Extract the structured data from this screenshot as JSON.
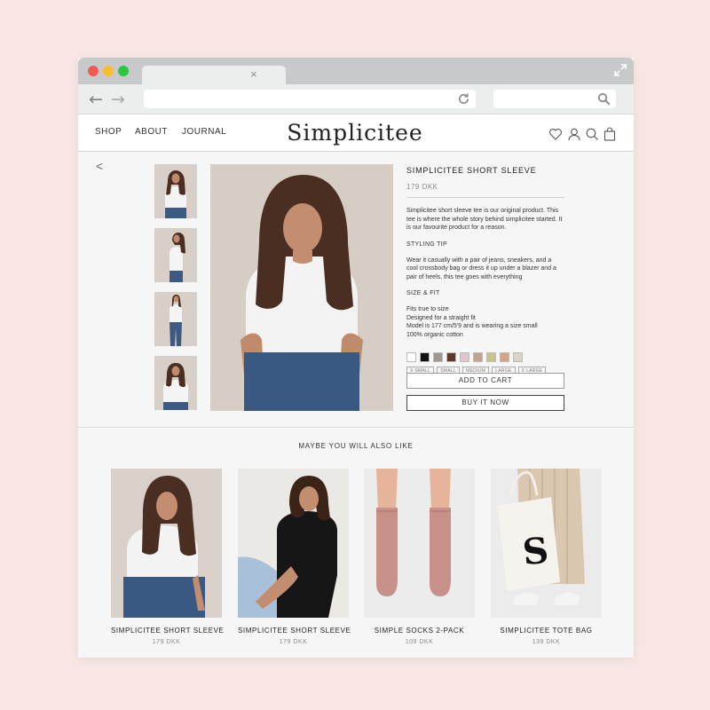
{
  "browser": {
    "icons": [
      "back-arrow-icon",
      "forward-arrow-icon",
      "reload-icon",
      "search-icon",
      "expand-icon",
      "close-icon"
    ],
    "back_glyph": "←",
    "forward_glyph": "→",
    "tab_close_glyph": "×"
  },
  "header": {
    "nav": [
      "SHOP",
      "ABOUT",
      "JOURNAL"
    ],
    "brand": "Simplicitee",
    "icons": [
      "heart-icon",
      "user-icon",
      "search-icon",
      "bag-icon"
    ]
  },
  "product": {
    "back_glyph": "<",
    "title": "SIMPLICITEE SHORT SLEEVE",
    "price": "179 DKK",
    "description": "Simplicitee short sleeve tee is our original product. This tee is where the whole story behind simplicitee started. It is our favourite product for a reason.",
    "styling_label": "STYLING TIP",
    "styling_text": "Wear it casually with a pair of jeans, sneakers, and a cool crossbody bag or dress it up under a blazer and a pair of heels, this tee goes with everything",
    "fit_label": "SIZE & FIT",
    "fit_lines": [
      "Fits true to size",
      "Designed for a straight fit",
      "Model is 177 cm/5'9 and is wearing a size small",
      "100% organic cotton"
    ],
    "colors": [
      "#ffffff",
      "#111111",
      "#a19690",
      "#5b3a2e",
      "#dfc6cb",
      "#c1a396",
      "#c7c58a",
      "#d6a38a",
      "#d8d4c6"
    ],
    "sizes": [
      "X SMALL",
      "SMALL",
      "MEDIUM",
      "LARGE",
      "X LARGE"
    ],
    "add_to_cart": "ADD TO CART",
    "buy_now": "BUY IT NOW"
  },
  "recommendations": {
    "title": "MAYBE YOU WILL ALSO LIKE",
    "items": [
      {
        "name": "SIMPLICITEE SHORT SLEEVE",
        "price": "179 DKK"
      },
      {
        "name": "SIMPLICITEE SHORT SLEEVE",
        "price": "179 DKK"
      },
      {
        "name": "SIMPLE SOCKS 2-PACK",
        "price": "109 DKK"
      },
      {
        "name": "SIMPLICITEE TOTE BAG",
        "price": "139 DKK",
        "logo_letter": "S"
      }
    ]
  },
  "colors": {
    "page_background": "#f7e6e4",
    "chrome": "#c7c9cb",
    "text": "#222222"
  }
}
